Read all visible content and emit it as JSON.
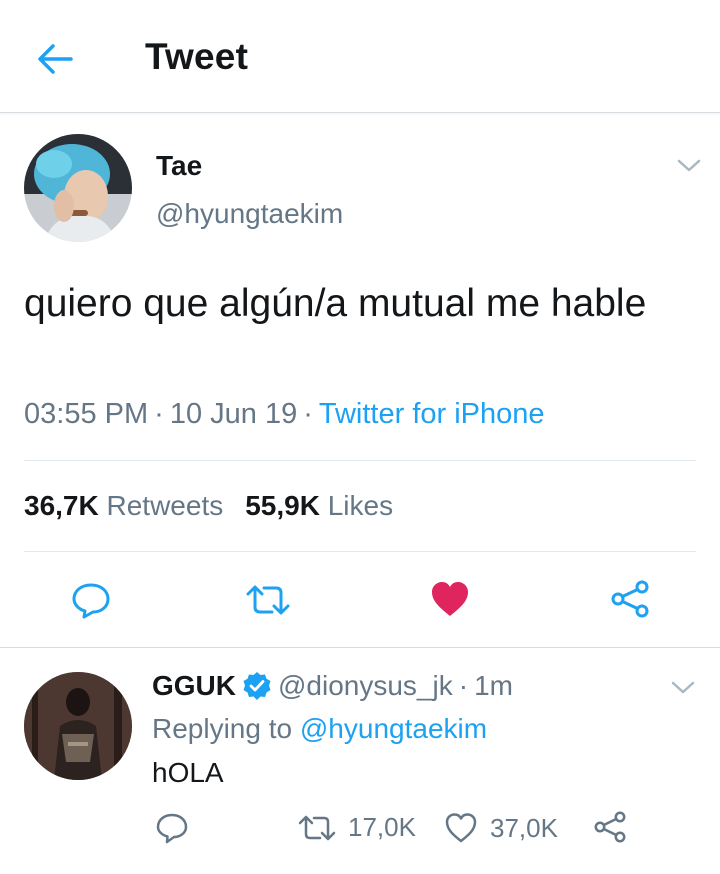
{
  "header": {
    "title": "Tweet",
    "back_icon": "arrow-left-icon"
  },
  "colors": {
    "accent": "#1da1f2",
    "muted": "#657786",
    "text": "#14171a",
    "like": "#e0245e",
    "verified": "#1da1f2"
  },
  "tweet": {
    "author_name": "Tae",
    "author_handle": "@hyungtaekim",
    "text": "quiero que algún/a mutual me hable",
    "time": "03:55 PM",
    "date": "10 Jun 19",
    "separator": "·",
    "source": "Twitter for iPhone",
    "retweets_count": "36,7K",
    "retweets_label": "Retweets",
    "likes_count": "55,9K",
    "likes_label": "Likes",
    "liked": true
  },
  "reply": {
    "author_name": "GGUK",
    "verified": true,
    "author_handle": "@dionysus_jk",
    "separator": "·",
    "time_ago": "1m",
    "replying_to_label": "Replying to",
    "replying_to_handle": "@hyungtaekim",
    "text": "hOLA",
    "retweets_count": "17,0K",
    "likes_count": "37,0K"
  }
}
